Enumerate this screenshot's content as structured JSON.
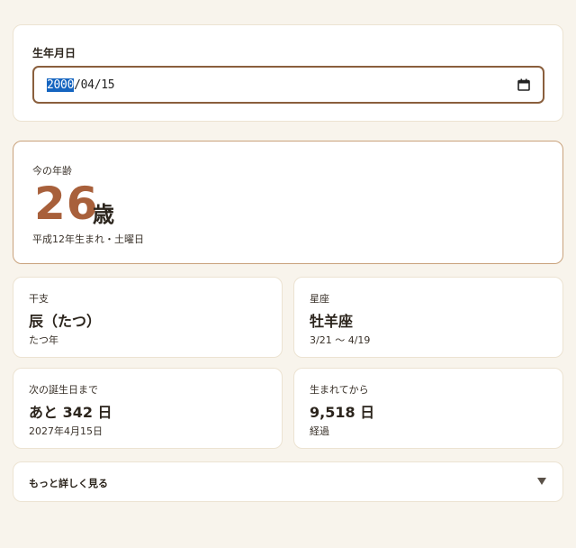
{
  "birth": {
    "label": "生年月日",
    "value_year": "2000",
    "value_rest": "/04/15",
    "icon": "calendar-icon"
  },
  "age": {
    "label": "今の年齢",
    "number": "26",
    "unit": "歳",
    "detail": "平成12年生まれ・土曜日"
  },
  "cards": {
    "eto": {
      "label": "干支",
      "main": "辰（たつ）",
      "sub": "たつ年"
    },
    "zodiac": {
      "label": "星座",
      "main": "牡羊座",
      "sub": "3/21 〜 4/19"
    },
    "next_birthday": {
      "label": "次の誕生日まで",
      "main": "あと 342 日",
      "sub": "2027年4月15日"
    },
    "since_birth": {
      "label": "生まれてから",
      "main": "9,518 日",
      "sub": "経過"
    }
  },
  "more": {
    "label": "もっと詳しく見る",
    "icon": "triangle-down-icon"
  },
  "colors": {
    "background": "#f8f4ec",
    "accent": "#a8603b",
    "input_border": "#8a5f3d",
    "highlight_border": "#c9a27c",
    "selection": "#1565c0"
  }
}
